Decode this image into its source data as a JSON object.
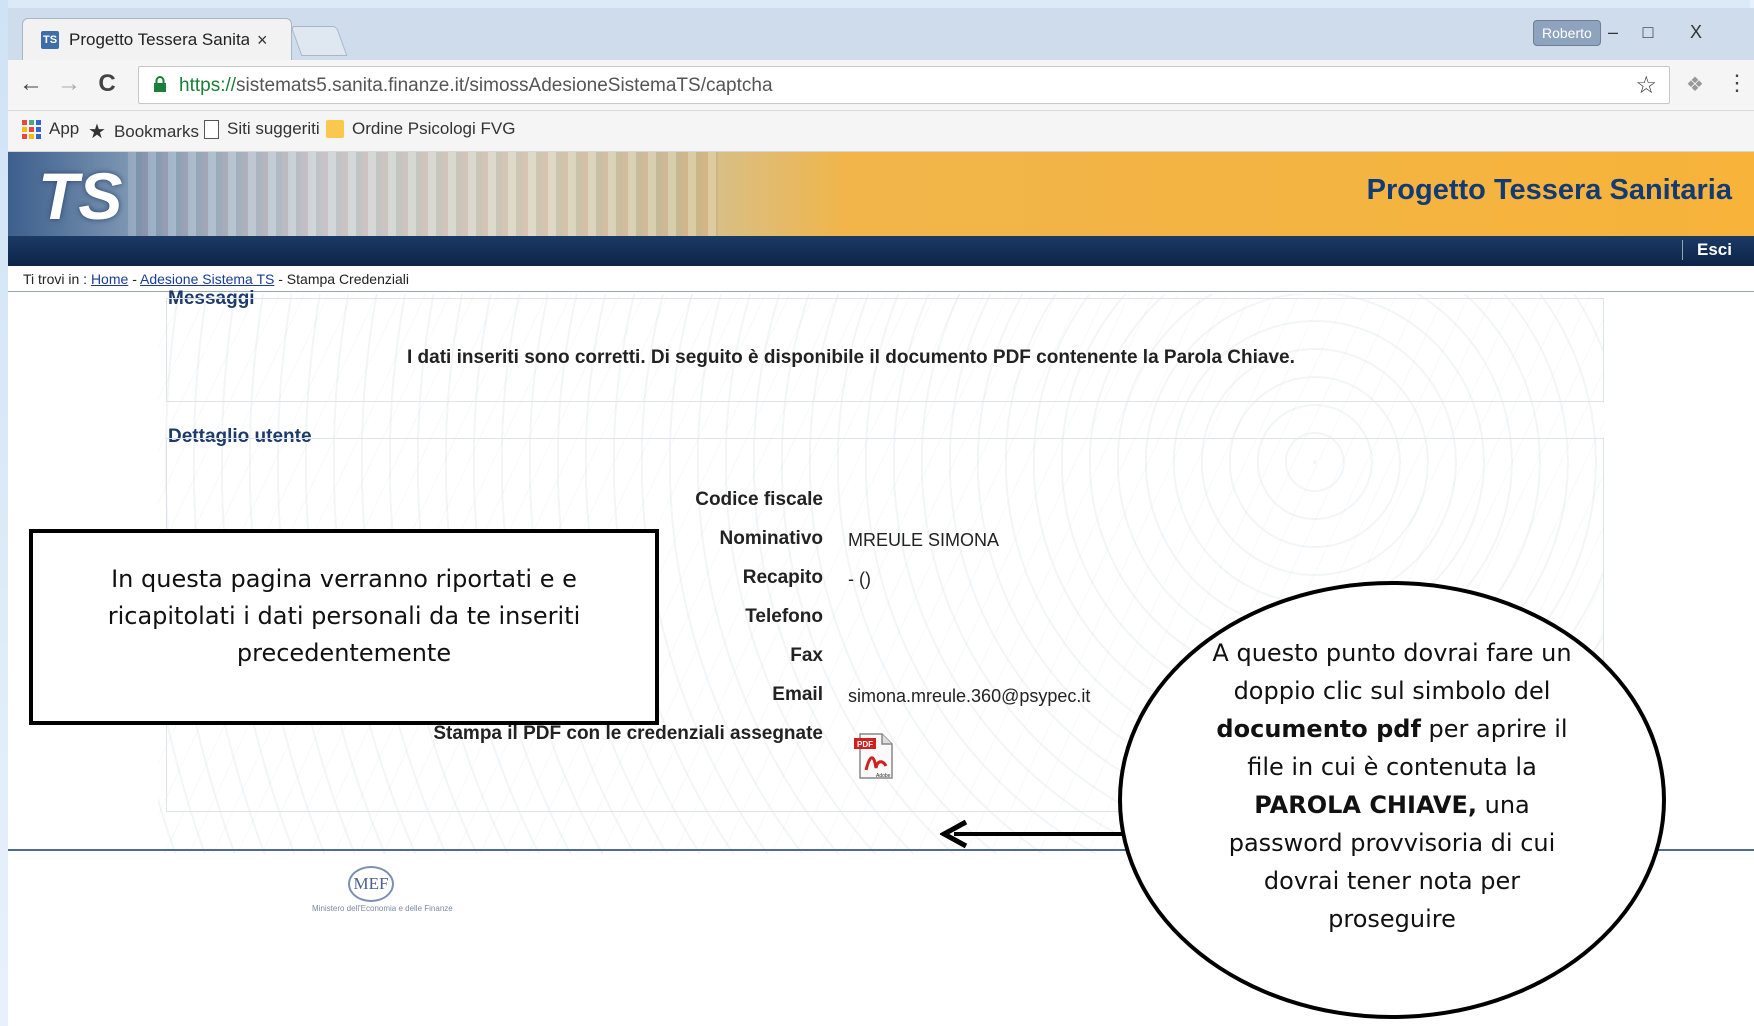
{
  "browser": {
    "tab_title": "Progetto Tessera Sanitari",
    "tab_close": "×",
    "user_badge": "Roberto",
    "window_controls": {
      "minimize": "–",
      "maximize": "□",
      "close": "X"
    },
    "url_scheme": "https://",
    "url_host": "sistemats5.sanita.finanze.it",
    "url_path": "/simossAdesioneSistemaTS/captcha",
    "nav": {
      "back": "←",
      "forward": "→",
      "reload": "C"
    },
    "bookmarks": [
      {
        "label": "App",
        "icon": "apps-grid-icon"
      },
      {
        "label": "Bookmarks",
        "icon": "star-icon"
      },
      {
        "label": "Siti suggeriti",
        "icon": "page-icon"
      },
      {
        "label": "Ordine Psicologi FVG",
        "icon": "folder-icon"
      }
    ]
  },
  "page": {
    "logo": "TS",
    "banner_title": "Progetto Tessera Sanitaria",
    "exit_label": "Esci",
    "breadcrumb": {
      "prefix": "Ti trovi in :",
      "home": "Home",
      "sep1": "-",
      "adesione": "Adesione Sistema TS",
      "current": "- Stampa Credenziali"
    },
    "messages": {
      "title": "Messaggi",
      "text": "I dati inseriti sono corretti. Di seguito è disponibile il documento PDF contenente la Parola Chiave."
    },
    "user_detail": {
      "title": "Dettaglio utente",
      "fields": [
        {
          "label": "Codice fiscale",
          "value": ""
        },
        {
          "label": "Nominativo",
          "value": "MREULE SIMONA"
        },
        {
          "label": "Recapito",
          "value": "- ()"
        },
        {
          "label": "Telefono",
          "value": ""
        },
        {
          "label": "Fax",
          "value": ""
        },
        {
          "label": "Email",
          "value": "simona.mreule.360@psypec.it"
        }
      ],
      "print_label": "Stampa il PDF con le credenziali assegnate",
      "pdf_icon_text": "PDF",
      "pdf_icon_sub": "Adobe"
    },
    "footer": {
      "logo": "MEF",
      "sub": "Ministero dell'Economia e delle Finanze"
    }
  },
  "annotations": {
    "box_text": "In questa pagina  verranno riportati e e ricapitolati i dati personali da te inseriti precedentemente",
    "oval_parts": {
      "a": "A questo punto dovrai fare un doppio clic sul simbolo del ",
      "b": "documento pdf",
      "c": " per aprire il file in cui è contenuta la ",
      "d": "PAROLA CHIAVE,",
      "e": " una password provvisoria di cui dovrai tener nota per proseguire"
    }
  }
}
